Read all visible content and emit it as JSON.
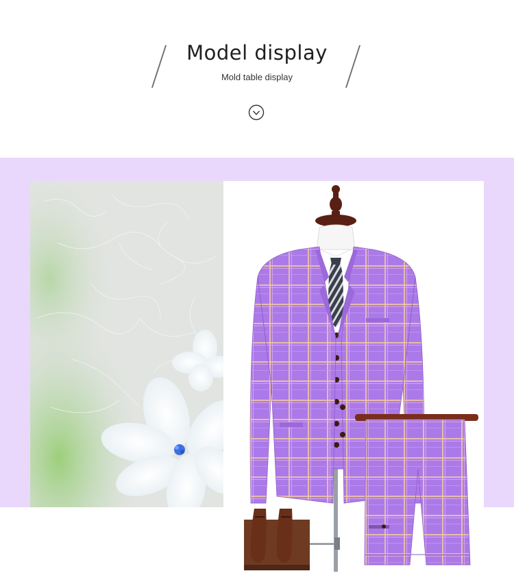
{
  "header": {
    "title": "Model display",
    "subtitle": "Mold table display",
    "chevron_icon": "chevron-down-circle-icon"
  },
  "colors": {
    "band": "#e9d8fb",
    "suit": "#a876e6",
    "check_lines": "#f2c9a0"
  },
  "images": {
    "left": "white-flower-decor-image",
    "right": "purple-plaid-three-piece-suit-on-mannequin-image"
  }
}
